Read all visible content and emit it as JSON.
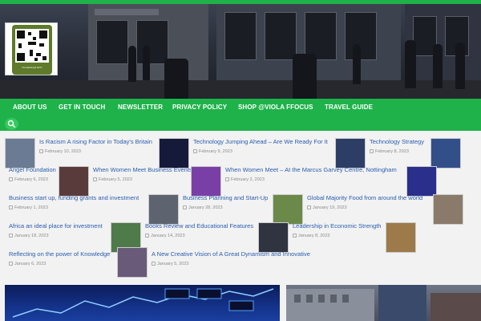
{
  "site": {
    "logo_caption": "FemaleAngel ECO"
  },
  "nav": {
    "items": [
      "ABOUT US",
      "GET IN TOUCH",
      "NEWSLETTER",
      "PRIVACY POLICY",
      "SHOP @VIOLA FFOCUS",
      "TRAVEL GUIDE"
    ]
  },
  "articles": [
    {
      "title": "Is Racism A rising Factor in Today's Britain",
      "date": "February 10, 2023",
      "thumb": "#6b7b93"
    },
    {
      "title": "Technology Jumping Ahead – Are We Ready For It",
      "date": "February 9, 2023",
      "thumb": "#151a3a"
    },
    {
      "title": "Technology Strategy",
      "date": "February 8, 2023",
      "thumb": "#2c3e66"
    },
    {
      "title": "Angel Foundation",
      "date": "February 6, 2023",
      "thumb": "#324f8a"
    },
    {
      "title": "When Women Meet Business Events",
      "date": "February 5, 2023",
      "thumb": "#5a3b3b"
    },
    {
      "title": "When Women Meet – At the Marcus Garvey Centre, Nottingham",
      "date": "February 2, 2023",
      "thumb": "#7a3fa6"
    },
    {
      "title": "Business start up, funding grants and investment",
      "date": "February 1, 2023",
      "thumb": "#2a2f8c"
    },
    {
      "title": "Business Planning and Start-Up",
      "date": "January 28, 2023",
      "thumb": "#5d6470"
    },
    {
      "title": "Global Majority Food from around the world",
      "date": "January 19, 2023",
      "thumb": "#6b8a4a"
    },
    {
      "title": "Africa an ideal place for investment",
      "date": "January 18, 2023",
      "thumb": "#8a7a6a"
    },
    {
      "title": "Books Review and Educational Features",
      "date": "January 14, 2023",
      "thumb": "#4f7a4a"
    },
    {
      "title": "Leadership in Economic Strength",
      "date": "January 8, 2023",
      "thumb": "#2f3440"
    },
    {
      "title": "Reflecting on the power of Knowledge",
      "date": "January 6, 2023",
      "thumb": "#9c7a4a"
    },
    {
      "title": "A New Creative Vision of A Great Dynamism and Innovative",
      "date": "January 5, 2023",
      "thumb": "#6a5a7a"
    }
  ]
}
